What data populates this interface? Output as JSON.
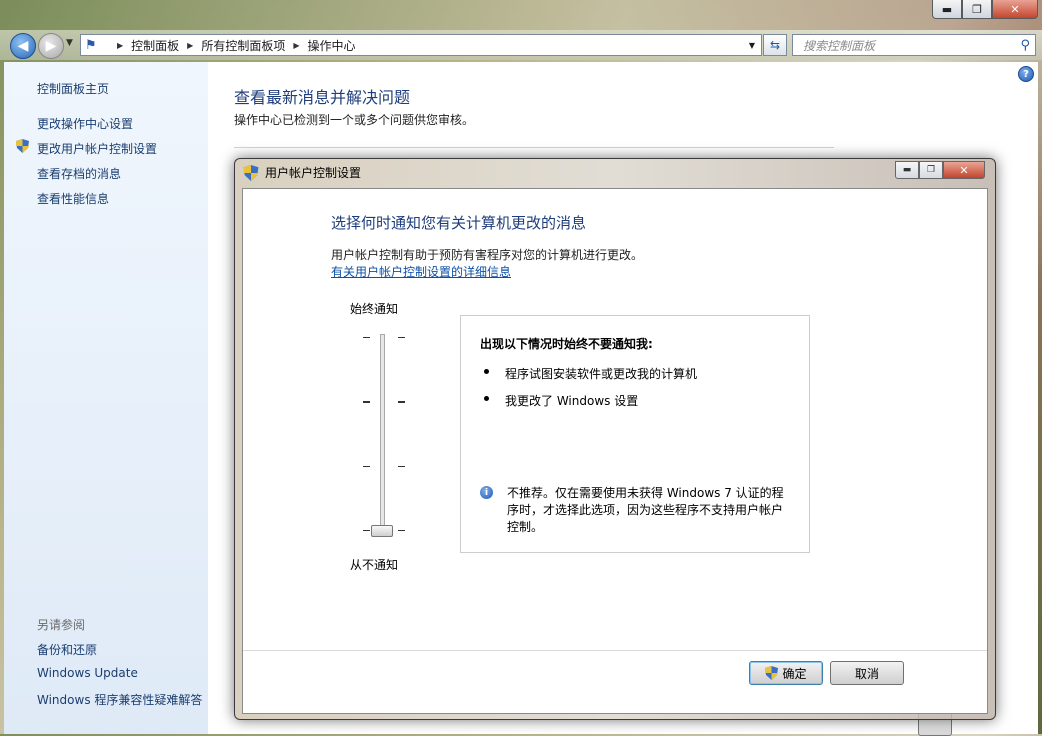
{
  "window": {
    "min_label": "▬",
    "max_label": "❐",
    "close_label": "✕"
  },
  "nav": {
    "breadcrumb": [
      "控制面板",
      "所有控制面板项",
      "操作中心"
    ],
    "search_placeholder": "搜索控制面板"
  },
  "sidebar": {
    "items": [
      {
        "label": "控制面板主页"
      },
      {
        "label": "更改操作中心设置"
      },
      {
        "label": "更改用户帐户控制设置"
      },
      {
        "label": "查看存档的消息"
      },
      {
        "label": "查看性能信息"
      }
    ],
    "see_also_header": "另请参阅",
    "see_also": [
      {
        "label": "备份和还原"
      },
      {
        "label": "Windows Update"
      },
      {
        "label": "Windows 程序兼容性疑难解答"
      }
    ]
  },
  "main": {
    "title": "查看最新消息并解决问题",
    "subtitle": "操作中心已检测到一个或多个问题供您审核。"
  },
  "dialog": {
    "title": "用户帐户控制设置",
    "heading": "选择何时通知您有关计算机更改的消息",
    "description": "用户帐户控制有助于预防有害程序对您的计算机进行更改。",
    "link": "有关用户帐户控制设置的详细信息",
    "slider": {
      "top_label": "始终通知",
      "bottom_label": "从不通知",
      "level": 0,
      "levels": 4
    },
    "info": {
      "title": "出现以下情况时始终不要通知我:",
      "items": [
        "程序试图安装软件或更改我的计算机",
        "我更改了 Windows 设置"
      ],
      "note": "不推荐。仅在需要使用未获得 Windows 7 认证的程序时，才选择此选项，因为这些程序不支持用户帐户控制。"
    },
    "ok_label": "确定",
    "cancel_label": "取消"
  }
}
